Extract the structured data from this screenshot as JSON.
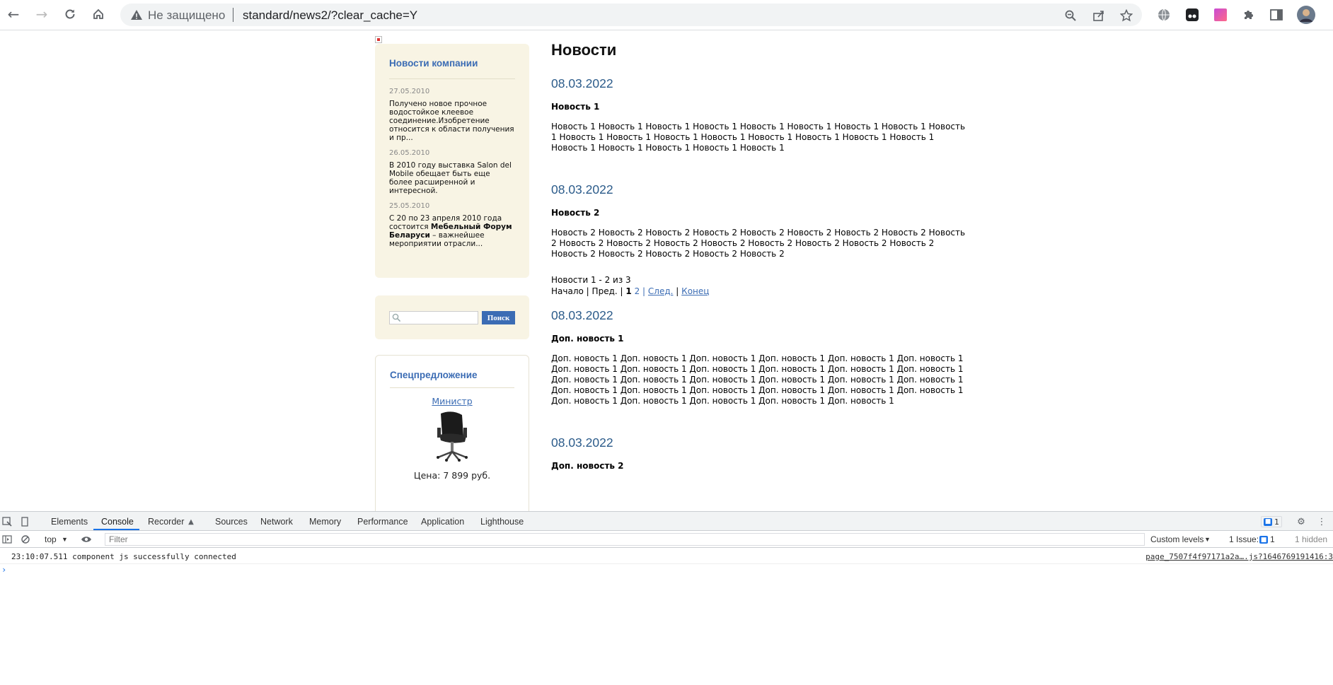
{
  "browser": {
    "insecure_label": "Не защищено",
    "url": "standard/news2/?clear_cache=Y"
  },
  "sidebar": {
    "news_title": "Новости компании",
    "news_items": [
      {
        "date": "27.05.2010",
        "text": "Получено новое прочное водостойкое клеевое соединение.Изобретение относится к области получения и пр..."
      },
      {
        "date": "26.05.2010",
        "text": "В 2010 году выставка Salon del Mobile обещает быть еще более расширенной и интересной."
      },
      {
        "date": "25.05.2010",
        "text_before": "С 20 по 23 апреля 2010 года состоится ",
        "text_bold": "Мебельный Форум Беларуси",
        "text_after": " – важнейшее мероприятии отрасли..."
      }
    ],
    "search_button": "Поиск",
    "search_value": "",
    "offer_title": "Спецпредложение",
    "offer_link": "Министр",
    "offer_price": "Цена: 7 899 руб."
  },
  "main": {
    "title": "Новости",
    "news": [
      {
        "date": "08.03.2022",
        "title": "Новость 1",
        "body": "Новость 1 Новость 1 Новость 1 Новость 1 Новость 1 Новость 1 Новость 1 Новость 1 Новость 1 Новость 1 Новость 1 Новость 1 Новость 1 Новость 1 Новость 1 Новость 1 Новость 1 Новость 1 Новость 1 Новость 1 Новость 1 Новость 1"
      },
      {
        "date": "08.03.2022",
        "title": "Новость 2",
        "body": "Новость 2 Новость 2 Новость 2 Новость 2 Новость 2 Новость 2 Новость 2 Новость 2 Новость 2 Новость 2 Новость 2 Новость 2 Новость 2 Новость 2 Новость 2 Новость 2 Новость 2 Новость 2 Новость 2 Новость 2 Новость 2 Новость 2"
      }
    ],
    "pager": {
      "summary": "Новости 1 - 2 из 3",
      "first": "Начало",
      "prev": "Пред.",
      "current": "1",
      "page2": "2",
      "next": "След.",
      "last": "Конец",
      "sep": "|"
    },
    "extra_news": [
      {
        "date": "08.03.2022",
        "title": "Доп. новость 1",
        "body": "Доп. новость 1 Доп. новость 1 Доп. новость 1 Доп. новость 1 Доп. новость 1 Доп. новость 1 Доп. новость 1 Доп. новость 1 Доп. новость 1 Доп. новость 1 Доп. новость 1 Доп. новость 1 Доп. новость 1 Доп. новость 1 Доп. новость 1 Доп. новость 1 Доп. новость 1 Доп. новость 1 Доп. новость 1 Доп. новость 1 Доп. новость 1 Доп. новость 1 Доп. новость 1 Доп. новость 1 Доп. новость 1 Доп. новость 1 Доп. новость 1 Доп. новость 1 Доп. новость 1"
      },
      {
        "date": "08.03.2022",
        "title": "Доп. новость 2"
      }
    ]
  },
  "devtools": {
    "tabs": [
      "Elements",
      "Console",
      "Recorder",
      "Sources",
      "Network",
      "Memory",
      "Performance",
      "Application",
      "Lighthouse"
    ],
    "context": "top",
    "filter_placeholder": "Filter",
    "levels": "Custom levels",
    "issues_label": "1 Issue:",
    "issues_count": "1",
    "messages_count": "1",
    "hidden": "1 hidden",
    "log_text": "23:10:07.511 component js successfully connected",
    "log_source": "page_7507f4f97171a2a….js?1646769191416:3"
  },
  "colors": {
    "link": "#3b6cb4",
    "date": "#2b5b8a",
    "sidebar_bg": "#f8f4e4",
    "devtools_accent": "#1a73e8"
  }
}
